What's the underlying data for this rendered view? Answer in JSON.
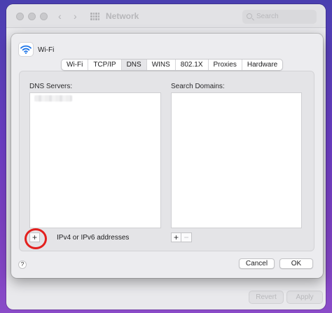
{
  "background_window": {
    "title": "Network",
    "search_placeholder": "Search",
    "revert_label": "Revert",
    "apply_label": "Apply"
  },
  "sheet": {
    "service_name": "Wi-Fi",
    "service_icon": "wifi-icon",
    "tabs": [
      {
        "label": "Wi-Fi",
        "selected": false
      },
      {
        "label": "TCP/IP",
        "selected": false
      },
      {
        "label": "DNS",
        "selected": true
      },
      {
        "label": "WINS",
        "selected": false
      },
      {
        "label": "802.1X",
        "selected": false
      },
      {
        "label": "Proxies",
        "selected": false
      },
      {
        "label": "Hardware",
        "selected": false
      }
    ],
    "dns_servers_label": "DNS Servers:",
    "search_domains_label": "Search Domains:",
    "add_symbol": "+",
    "remove_symbol": "−",
    "address_hint": "IPv4 or IPv6 addresses",
    "help_symbol": "?",
    "cancel_label": "Cancel",
    "ok_label": "OK"
  },
  "colors": {
    "highlight_ring": "#e3201e",
    "wifi_blue": "#1a73e8"
  }
}
